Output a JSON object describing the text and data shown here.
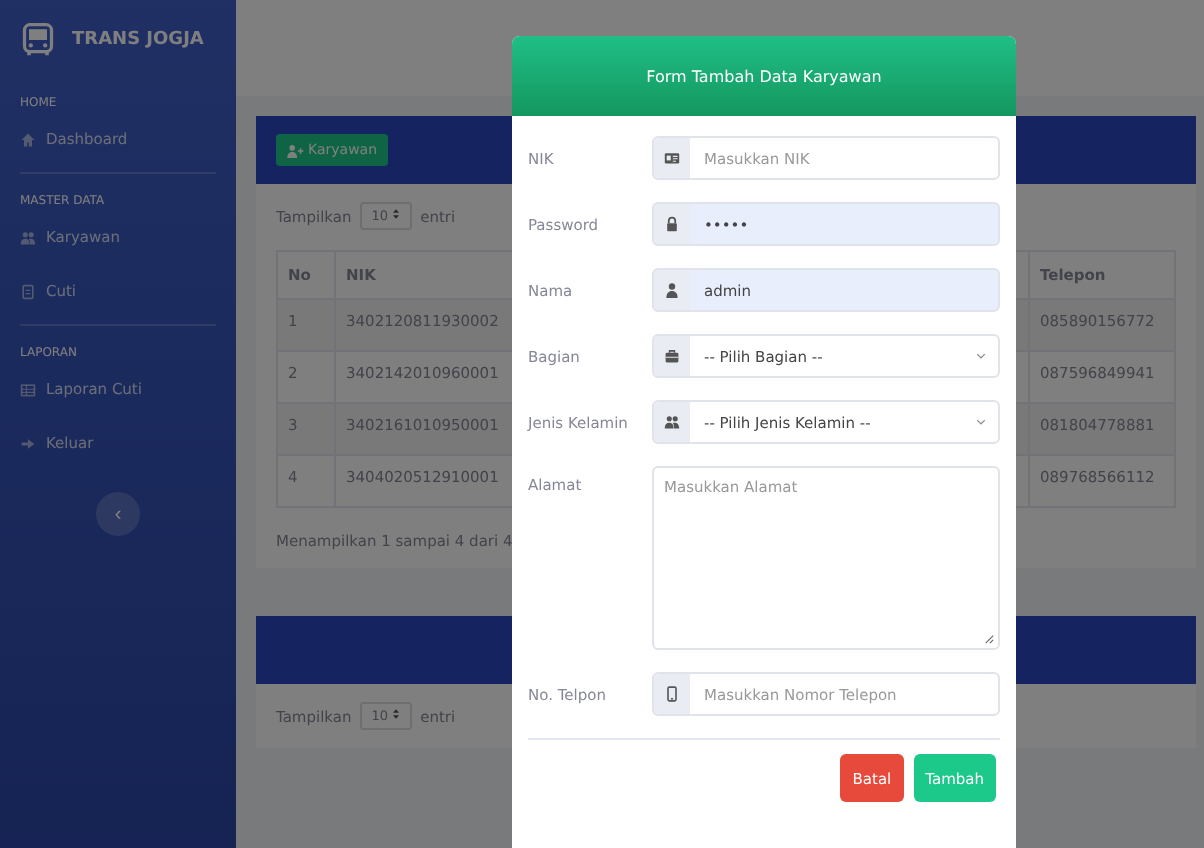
{
  "sidebar": {
    "brand": "TRANS JOGJA",
    "sections": [
      {
        "heading": "HOME",
        "items": [
          {
            "label": "Dashboard"
          }
        ]
      },
      {
        "heading": "MASTER DATA",
        "items": [
          {
            "label": "Karyawan"
          },
          {
            "label": "Cuti"
          }
        ]
      },
      {
        "heading": "LAPORAN",
        "items": [
          {
            "label": "Laporan Cuti"
          },
          {
            "label": "Keluar"
          }
        ]
      }
    ],
    "toggle": "‹"
  },
  "cards": [
    {
      "button": "Karyawan",
      "show_label": "Tampilkan",
      "page_size": "10",
      "entries_label": "entri",
      "columns": [
        "No",
        "NIK",
        "Telepon"
      ],
      "rows": [
        {
          "no": "1",
          "nik": "3402120811930002",
          "telepon": "085890156772"
        },
        {
          "no": "2",
          "nik": "3402142010960001",
          "telepon": "087596849941"
        },
        {
          "no": "3",
          "nik": "3402161010950001",
          "telepon": "081804778881"
        },
        {
          "no": "4",
          "nik": "3404020512910001",
          "telepon": "089768566112"
        }
      ],
      "footer": "Menampilkan 1 sampai 4 dari 4"
    },
    {
      "show_label": "Tampilkan",
      "page_size": "10",
      "entries_label": "entri"
    }
  ],
  "modal": {
    "title": "Form Tambah Data Karyawan",
    "fields": [
      {
        "label": "NIK",
        "kind": "text",
        "placeholder": "Masukkan NIK",
        "filled": false
      },
      {
        "label": "Password",
        "kind": "text",
        "value": "•••••",
        "filled": true
      },
      {
        "label": "Nama",
        "kind": "text",
        "value": "admin",
        "filled": true
      },
      {
        "label": "Bagian",
        "kind": "select",
        "value": "-- Pilih Bagian --"
      },
      {
        "label": "Jenis Kelamin",
        "kind": "select",
        "value": "-- Pilih Jenis Kelamin --"
      },
      {
        "label": "Alamat",
        "kind": "textarea",
        "placeholder": "Masukkan Alamat"
      },
      {
        "label": "No. Telpon",
        "kind": "text",
        "placeholder": "Masukkan Nomor Telepon",
        "filled": false
      }
    ],
    "buttons": [
      {
        "label": "Batal",
        "kind": "danger"
      },
      {
        "label": "Tambah",
        "kind": "success"
      }
    ]
  }
}
